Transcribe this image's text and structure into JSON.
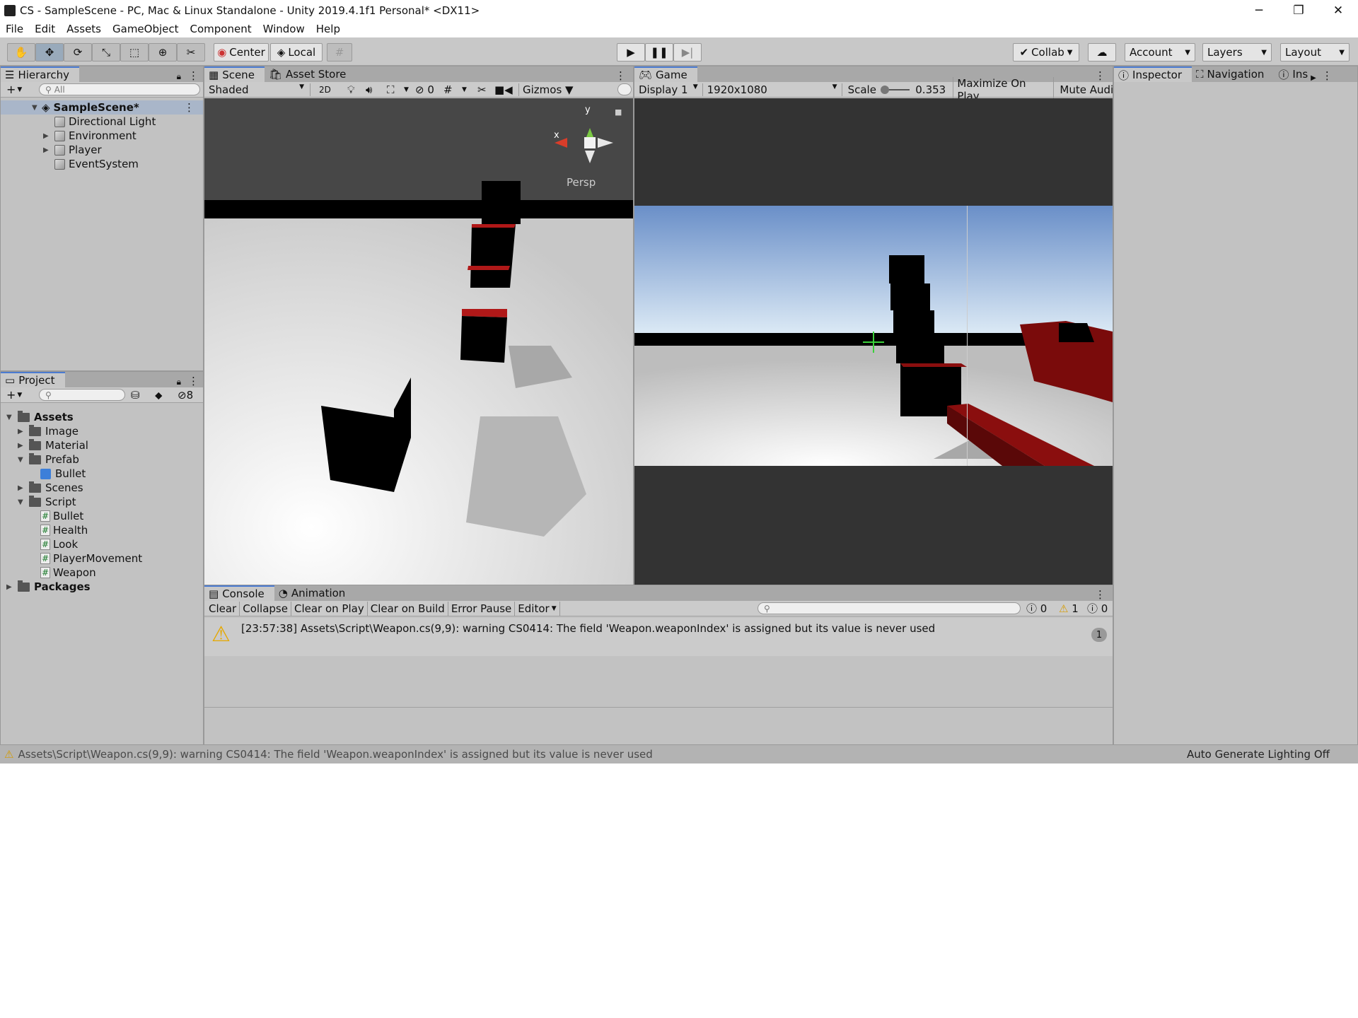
{
  "window": {
    "title": "CS - SampleScene - PC, Mac & Linux Standalone - Unity 2019.4.1f1 Personal* <DX11>",
    "minimize": "─",
    "restore": "❐",
    "close": "✕"
  },
  "menu": [
    "File",
    "Edit",
    "Assets",
    "GameObject",
    "Component",
    "Window",
    "Help"
  ],
  "toolbar": {
    "pivot": "Center",
    "space": "Local",
    "collab": "Collab",
    "account": "Account",
    "layers": "Layers",
    "layout": "Layout"
  },
  "hierarchy": {
    "tab": "Hierarchy",
    "search_placeholder": "All",
    "scene": "SampleScene*",
    "items": [
      "Directional Light",
      "Environment",
      "Player",
      "EventSystem"
    ]
  },
  "project": {
    "tab": "Project",
    "hidden_count": "8",
    "items": [
      {
        "label": "Assets"
      },
      {
        "label": "Image"
      },
      {
        "label": "Material"
      },
      {
        "label": "Prefab"
      },
      {
        "label": "Bullet"
      },
      {
        "label": "Scenes"
      },
      {
        "label": "Script"
      },
      {
        "label": "Bullet"
      },
      {
        "label": "Health"
      },
      {
        "label": "Look"
      },
      {
        "label": "PlayerMovement"
      },
      {
        "label": "Weapon"
      },
      {
        "label": "Packages"
      }
    ]
  },
  "scene": {
    "tab": "Scene",
    "tab2": "Asset Store",
    "shading": "Shaded",
    "mode2d": "2D",
    "hidden": "0",
    "gizmos": "Gizmos",
    "persp": "Persp",
    "axis_y": "y",
    "axis_x": "x"
  },
  "game": {
    "tab": "Game",
    "display": "Display 1",
    "resolution": "1920x1080",
    "scale_label": "Scale",
    "scale_value": "0.353",
    "maximize": "Maximize On Play",
    "mute": "Mute Audi"
  },
  "inspector": {
    "tab": "Inspector",
    "tab2": "Navigation",
    "tab3": "Ins"
  },
  "console": {
    "tab": "Console",
    "tab2": "Animation",
    "buttons": [
      "Clear",
      "Collapse",
      "Clear on Play",
      "Clear on Build",
      "Error Pause",
      "Editor"
    ],
    "count_errors": "0",
    "count_warnings": "1",
    "count_info": "0",
    "message": "[23:57:38] Assets\\Script\\Weapon.cs(9,9): warning CS0414: The field 'Weapon.weaponIndex' is assigned but its value is never used",
    "collapse_count": "1"
  },
  "status": {
    "message": "Assets\\Script\\Weapon.cs(9,9): warning CS0414: The field 'Weapon.weaponIndex' is assigned but its value is never used",
    "lighting": "Auto Generate Lighting Off"
  }
}
